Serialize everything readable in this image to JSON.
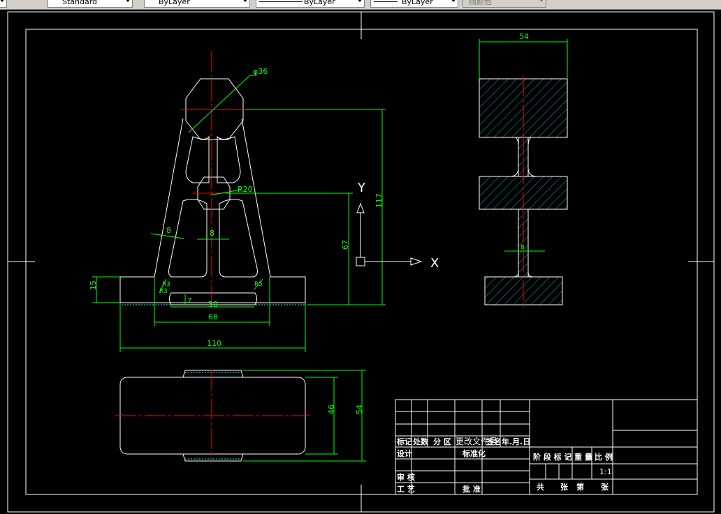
{
  "toolbar": {
    "text_style": "Standard",
    "layer_control": "ByLayer",
    "linetype": "ByLayer",
    "lineweight": "ByLayer",
    "plot_style": "随颜色"
  },
  "dims": {
    "d36": "φ36",
    "r20": "R20",
    "r3": "R3",
    "r3b": "R3",
    "r5": "R5",
    "h15": "15",
    "w8a": "8",
    "w8b": "8",
    "d7": "7",
    "w50": "50",
    "w68": "68",
    "w110": "110",
    "h67": "67",
    "h117": "117",
    "w54top": "54",
    "w8side": "8",
    "h46": "46",
    "h54": "54"
  },
  "ucs": {
    "y_label": "Y",
    "x_label": "X"
  },
  "title_block": {
    "row1": [
      "标记",
      "处数",
      "分 区",
      "更改文件号",
      "签名",
      "年.月.日"
    ],
    "design": "设计",
    "standard": "标准化",
    "stage_mark": "阶 段 标 记",
    "weight": "重 量",
    "scale": "比 例",
    "scale_value": "1:1",
    "review": "审 核",
    "process": "工 艺",
    "approve": "批 准",
    "sheets": [
      "共",
      "张",
      "第",
      "张"
    ]
  },
  "colors": {
    "background": "#000000",
    "outline": "#ffffff",
    "dimension": "#00ff00",
    "centerline": "#ff0000",
    "hatch": "#00b0b0"
  }
}
